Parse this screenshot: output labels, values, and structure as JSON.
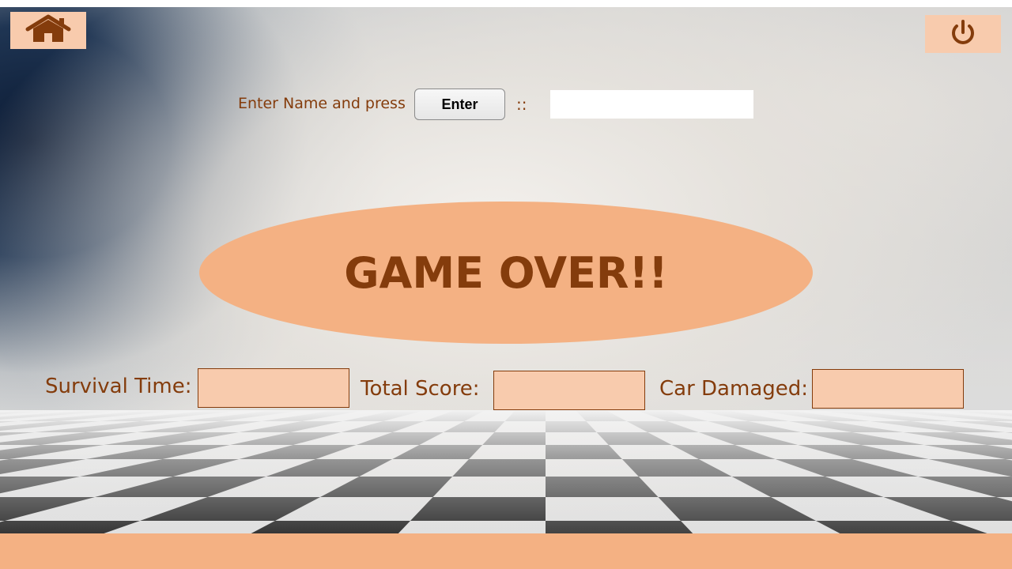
{
  "toolbar": {
    "home_icon": "home-icon",
    "power_icon": "power-icon"
  },
  "name_entry": {
    "prompt": "Enter Name and press",
    "enter_label": "Enter",
    "separator": "::",
    "value": "",
    "placeholder": ""
  },
  "banner": {
    "title": "GAME OVER!!"
  },
  "stats": {
    "survival_time_label": "Survival Time:",
    "survival_time_value": "",
    "total_score_label": "Total Score:",
    "total_score_value": "",
    "car_damaged_label": "Car Damaged:",
    "car_damaged_value": ""
  },
  "colors": {
    "accent": "#f4b183",
    "accent_light": "#f8cbad",
    "text_brown": "#843c0c"
  }
}
